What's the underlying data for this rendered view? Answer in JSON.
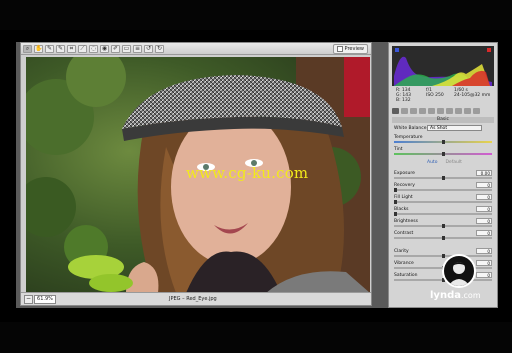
{
  "watermark": "www.cg-ku.com",
  "toolbar": {
    "tools": [
      "zoom",
      "hand",
      "white-balance",
      "color-sampler",
      "crop",
      "straighten",
      "spot-removal",
      "red-eye",
      "adjustment-brush",
      "graduated-filter",
      "preferences",
      "rotate-left",
      "rotate-right"
    ],
    "preview_label": "Preview"
  },
  "status": {
    "zoom_value": "61.9%",
    "filename": "JPEG – Red_Eye.jpg"
  },
  "readout": {
    "r": "R: 134",
    "g": "G: 143",
    "b": "B: 132",
    "aperture": "f/1",
    "shutter": "1/60 s",
    "iso": "ISO 250",
    "lens": "24-105@32 mm"
  },
  "panel": {
    "section_title": "Basic",
    "white_balance_label": "White Balance:",
    "white_balance_value": "As Shot",
    "auto_label": "Auto",
    "default_label": "Default",
    "sliders": [
      {
        "label": "Temperature",
        "value": "",
        "pos": 0.5,
        "style": "temp"
      },
      {
        "label": "Tint",
        "value": "",
        "pos": 0.5,
        "style": "tint"
      },
      {
        "label": "Exposure",
        "value": "0.00",
        "pos": 0.5,
        "style": "plain"
      },
      {
        "label": "Recovery",
        "value": "0",
        "pos": 0.0,
        "style": "plain"
      },
      {
        "label": "Fill Light",
        "value": "0",
        "pos": 0.0,
        "style": "plain"
      },
      {
        "label": "Blacks",
        "value": "0",
        "pos": 0.0,
        "style": "plain"
      },
      {
        "label": "Brightness",
        "value": "0",
        "pos": 0.5,
        "style": "plain"
      },
      {
        "label": "Contrast",
        "value": "0",
        "pos": 0.5,
        "style": "plain"
      },
      {
        "label": "Clarity",
        "value": "0",
        "pos": 0.5,
        "style": "plain"
      },
      {
        "label": "Vibrance",
        "value": "0",
        "pos": 0.5,
        "style": "plain"
      },
      {
        "label": "Saturation",
        "value": "0",
        "pos": 0.5,
        "style": "plain"
      }
    ]
  },
  "logo": {
    "brand": "lynda",
    "suffix": ".com"
  },
  "colors": {
    "background": "#000000",
    "panel": "#d4d4d4",
    "watermark": "#f2ea1a",
    "link": "#2e5fb5"
  }
}
